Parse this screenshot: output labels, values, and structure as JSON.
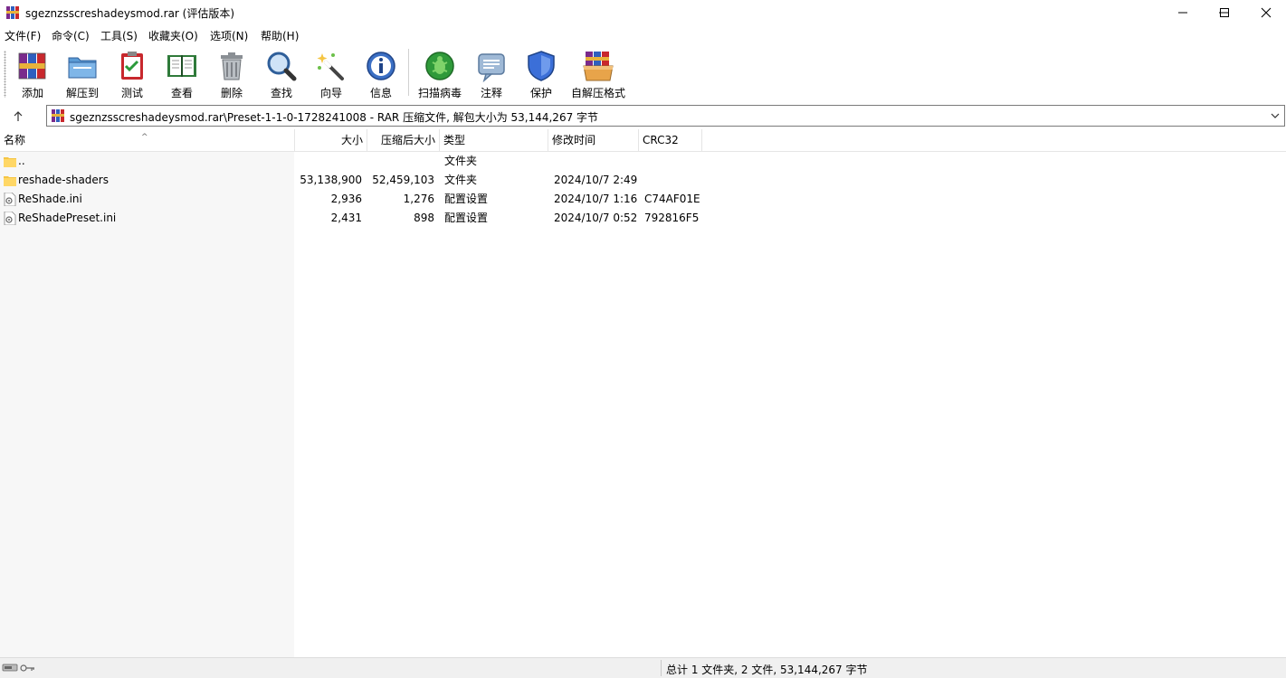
{
  "window": {
    "title": "sgeznzsscreshadeysmod.rar (评估版本)",
    "minimize_glyph": "─",
    "maximize_glyph": "☐",
    "close_glyph": "✕"
  },
  "menu": [
    "文件(F)",
    "命令(C)",
    "工具(S)",
    "收藏夹(O)",
    "选项(N)",
    "帮助(H)"
  ],
  "toolbar": [
    {
      "label": "添加",
      "icon": "add-archive-icon"
    },
    {
      "label": "解压到",
      "icon": "extract-to-icon"
    },
    {
      "label": "测试",
      "icon": "test-icon"
    },
    {
      "label": "查看",
      "icon": "view-icon"
    },
    {
      "label": "删除",
      "icon": "delete-icon"
    },
    {
      "label": "查找",
      "icon": "find-icon"
    },
    {
      "label": "向导",
      "icon": "wizard-icon"
    },
    {
      "label": "信息",
      "icon": "info-icon"
    },
    {
      "label": "扫描病毒",
      "icon": "scan-virus-icon"
    },
    {
      "label": "注释",
      "icon": "comment-icon"
    },
    {
      "label": "保护",
      "icon": "protect-icon"
    },
    {
      "label": "自解压格式",
      "icon": "sfx-icon"
    }
  ],
  "address": {
    "path": "sgeznzsscreshadeysmod.rar\\Preset-1-1-0-1728241008 - RAR 压缩文件, 解包大小为 53,144,267 字节"
  },
  "columns": {
    "name": "名称",
    "size": "大小",
    "packed": "压缩后大小",
    "type": "类型",
    "modified": "修改时间",
    "crc": "CRC32"
  },
  "files": [
    {
      "name": "..",
      "size": "",
      "packed": "",
      "type": "文件夹",
      "modified": "",
      "crc": "",
      "icon": "folder-icon"
    },
    {
      "name": "reshade-shaders",
      "size": "53,138,900",
      "packed": "52,459,103",
      "type": "文件夹",
      "modified": "2024/10/7 2:49",
      "crc": "",
      "icon": "folder-icon"
    },
    {
      "name": "ReShade.ini",
      "size": "2,936",
      "packed": "1,276",
      "type": "配置设置",
      "modified": "2024/10/7 1:16",
      "crc": "C74AF01E",
      "icon": "ini-file-icon"
    },
    {
      "name": "ReShadePreset.ini",
      "size": "2,431",
      "packed": "898",
      "type": "配置设置",
      "modified": "2024/10/7 0:52",
      "crc": "792816F5",
      "icon": "ini-file-icon"
    }
  ],
  "status": {
    "summary": "总计 1 文件夹, 2 文件, 53,144,267 字节"
  },
  "colors": {
    "folder": "#f5c543",
    "name_column_bg": "#f7f7f7",
    "statusbar_bg": "#f0f0f0"
  }
}
